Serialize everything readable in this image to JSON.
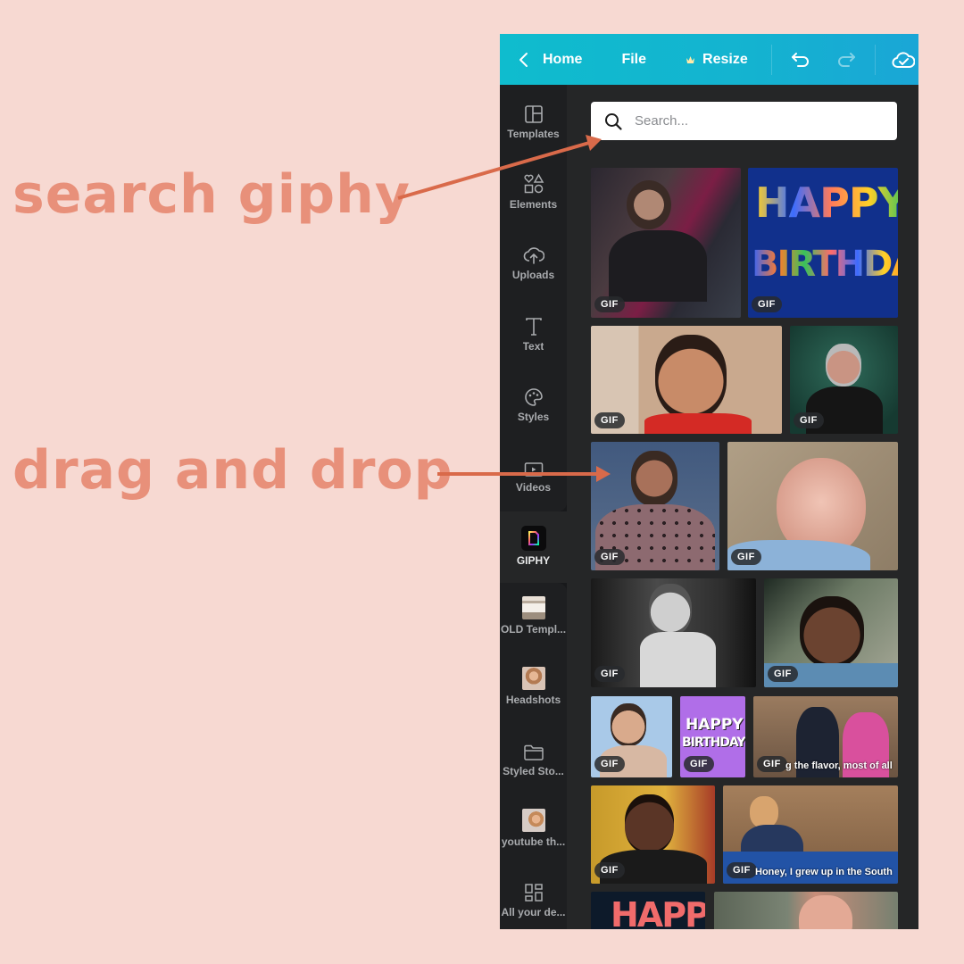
{
  "annotations": {
    "search": "search giphy",
    "drag": "drag and drop",
    "color": "#e8907a",
    "arrow_color": "#d96a4a"
  },
  "topbar": {
    "back_icon": "chevron-left-icon",
    "home_label": "Home",
    "file_label": "File",
    "resize_icon": "crown-icon",
    "resize_label": "Resize",
    "undo_icon": "undo-icon",
    "redo_icon": "redo-icon",
    "save_icon": "cloud-check-icon"
  },
  "sidebar": {
    "items": [
      {
        "label": "Templates",
        "icon": "templates-icon"
      },
      {
        "label": "Elements",
        "icon": "elements-icon"
      },
      {
        "label": "Uploads",
        "icon": "upload-cloud-icon"
      },
      {
        "label": "Text",
        "icon": "text-icon"
      },
      {
        "label": "Styles",
        "icon": "palette-icon"
      },
      {
        "label": "Videos",
        "icon": "video-icon"
      },
      {
        "label": "GIPHY",
        "icon": "giphy-icon",
        "active": true
      },
      {
        "label": "OLD Templ...",
        "icon": "folder-thumbnail"
      },
      {
        "label": "Headshots",
        "icon": "folder-thumbnail"
      },
      {
        "label": "Styled Sto...",
        "icon": "folder-icon"
      },
      {
        "label": "youtube th...",
        "icon": "folder-thumbnail"
      },
      {
        "label": "All your de...",
        "icon": "grid-icon"
      }
    ]
  },
  "panel": {
    "search_placeholder": "Search...",
    "search_value": "",
    "gif_badge": "GIF",
    "gifs": [
      {
        "desc": "gamer celebrating at desk"
      },
      {
        "desc": "Happy Birthday colorful letters",
        "text": "HAPPY BIRTHDAY"
      },
      {
        "desc": "man smiling fist pump"
      },
      {
        "desc": "older man gesturing excitedly"
      },
      {
        "desc": "man making heart with hands"
      },
      {
        "desc": "baby staring"
      },
      {
        "desc": "black and white child pondering"
      },
      {
        "desc": "man sleeping in car"
      },
      {
        "desc": "woman eating"
      },
      {
        "desc": "Happy Birthday purple card",
        "text": "HAPPY BIRTHDAY"
      },
      {
        "desc": "two women in kitchen",
        "caption": "g the flavor, most of all"
      },
      {
        "desc": "man staring"
      },
      {
        "desc": "woman cooking in kitchen",
        "caption": "Honey, I grew up in the South"
      },
      {
        "desc": "Happy text on navy",
        "text": "HAPPY"
      },
      {
        "desc": "baby outdoors"
      }
    ]
  }
}
